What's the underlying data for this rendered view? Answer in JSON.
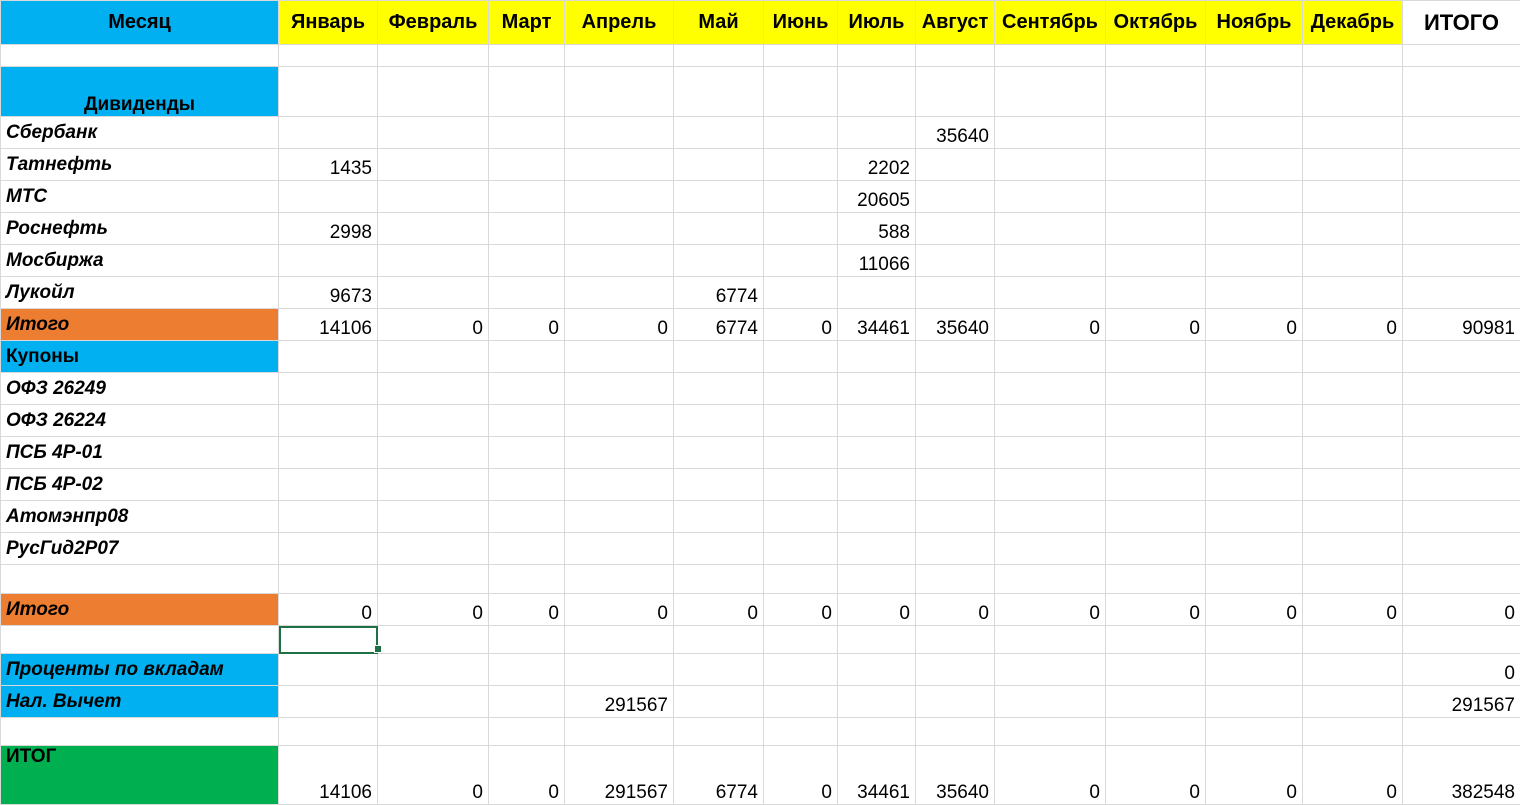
{
  "header": {
    "first": "Месяц",
    "months": [
      "Январь",
      "Февраль",
      "Март",
      "Апрель",
      "Май",
      "Июнь",
      "Июль",
      "Август",
      "Сентябрь",
      "Октябрь",
      "Ноябрь",
      "Декабрь"
    ],
    "total": "ИТОГО"
  },
  "dividends": {
    "title": "Дивиденды",
    "rows": [
      {
        "label": "Сбербанк",
        "values": [
          "",
          "",
          "",
          "",
          "",
          "",
          "",
          "35640",
          "",
          "",
          "",
          "",
          ""
        ]
      },
      {
        "label": "Татнефть",
        "values": [
          "1435",
          "",
          "",
          "",
          "",
          "",
          "2202",
          "",
          "",
          "",
          "",
          "",
          ""
        ]
      },
      {
        "label": "МТС",
        "values": [
          "",
          "",
          "",
          "",
          "",
          "",
          "20605",
          "",
          "",
          "",
          "",
          "",
          ""
        ]
      },
      {
        "label": "Роснефть",
        "values": [
          "2998",
          "",
          "",
          "",
          "",
          "",
          "588",
          "",
          "",
          "",
          "",
          "",
          ""
        ]
      },
      {
        "label": "Мосбиржа",
        "values": [
          "",
          "",
          "",
          "",
          "",
          "",
          "11066",
          "",
          "",
          "",
          "",
          "",
          ""
        ]
      },
      {
        "label": "Лукойл",
        "values": [
          "9673",
          "",
          "",
          "",
          "6774",
          "",
          "",
          "",
          "",
          "",
          "",
          "",
          ""
        ]
      }
    ],
    "total": {
      "label": "Итого",
      "values": [
        "14106",
        "0",
        "0",
        "0",
        "6774",
        "0",
        "34461",
        "35640",
        "0",
        "0",
        "0",
        "0",
        "90981"
      ]
    }
  },
  "coupons": {
    "title": "Купоны",
    "rows": [
      {
        "label": "ОФЗ 26249",
        "values": [
          "",
          "",
          "",
          "",
          "",
          "",
          "",
          "",
          "",
          "",
          "",
          "",
          ""
        ]
      },
      {
        "label": "ОФЗ 26224",
        "values": [
          "",
          "",
          "",
          "",
          "",
          "",
          "",
          "",
          "",
          "",
          "",
          "",
          ""
        ]
      },
      {
        "label": "ПСБ 4Р-01",
        "values": [
          "",
          "",
          "",
          "",
          "",
          "",
          "",
          "",
          "",
          "",
          "",
          "",
          ""
        ]
      },
      {
        "label": "ПСБ 4Р-02",
        "values": [
          "",
          "",
          "",
          "",
          "",
          "",
          "",
          "",
          "",
          "",
          "",
          "",
          ""
        ]
      },
      {
        "label": "Атомэнпр08",
        "values": [
          "",
          "",
          "",
          "",
          "",
          "",
          "",
          "",
          "",
          "",
          "",
          "",
          ""
        ]
      },
      {
        "label": "РусГид2Р07",
        "values": [
          "",
          "",
          "",
          "",
          "",
          "",
          "",
          "",
          "",
          "",
          "",
          "",
          ""
        ]
      }
    ],
    "total": {
      "label": "Итого",
      "values": [
        "0",
        "0",
        "0",
        "0",
        "0",
        "0",
        "0",
        "0",
        "0",
        "0",
        "0",
        "0",
        "0"
      ]
    }
  },
  "deposits": {
    "label": "Проценты по вкладам",
    "values": [
      "",
      "",
      "",
      "",
      "",
      "",
      "",
      "",
      "",
      "",
      "",
      "",
      "0"
    ]
  },
  "tax": {
    "label": "Нал. Вычет",
    "values": [
      "",
      "",
      "",
      "291567",
      "",
      "",
      "",
      "",
      "",
      "",
      "",
      "",
      "291567"
    ]
  },
  "grand": {
    "label": "ИТОГ",
    "values": [
      "14106",
      "0",
      "0",
      "291567",
      "6774",
      "0",
      "34461",
      "35640",
      "0",
      "0",
      "0",
      "0",
      "382548"
    ]
  },
  "colors": {
    "header_months": "#ffff00",
    "section_blue": "#00b0f0",
    "total_orange": "#ed7d31",
    "grand_green": "#00b050",
    "selection": "#1e7145"
  }
}
